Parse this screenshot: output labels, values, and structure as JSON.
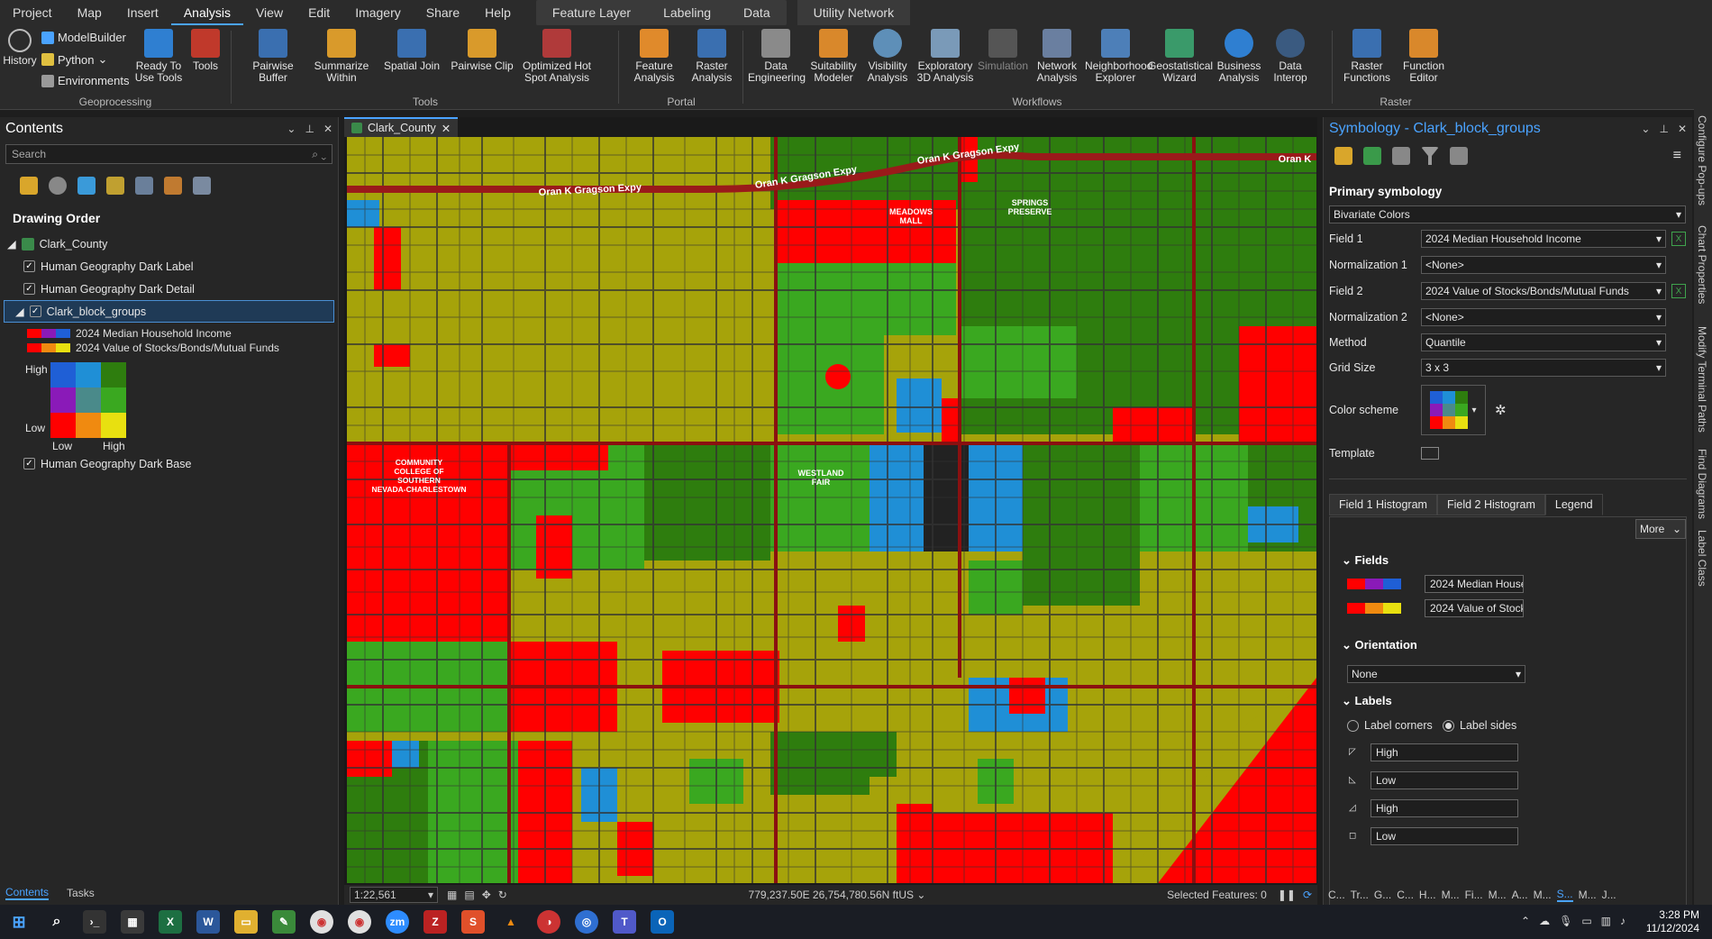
{
  "menu": [
    "Project",
    "Map",
    "Insert",
    "Analysis",
    "View",
    "Edit",
    "Imagery",
    "Share",
    "Help"
  ],
  "active_menu": "Analysis",
  "context_tabs": [
    "Feature Layer",
    "Labeling",
    "Data"
  ],
  "utility_tab": "Utility Network",
  "ribbon": {
    "geoprocessing": {
      "label": "Geoprocessing",
      "history": "History",
      "modelbuilder": "ModelBuilder",
      "python": "Python",
      "environments": "Environments",
      "ready": "Ready To Use Tools",
      "tools": "Tools"
    },
    "tools": {
      "label": "Tools",
      "items": [
        "Pairwise Buffer",
        "Summarize Within",
        "Spatial Join",
        "Pairwise Clip",
        "Optimized Hot Spot Analysis"
      ]
    },
    "portal": {
      "label": "Portal",
      "items": [
        "Feature Analysis",
        "Raster Analysis"
      ]
    },
    "workflows": {
      "label": "Workflows",
      "items": [
        "Data Engineering",
        "Suitability Modeler",
        "Visibility Analysis",
        "Exploratory 3D Analysis",
        "Simulation",
        "Network Analysis",
        "Neighborhood Explorer",
        "Geostatistical Wizard",
        "Business Analysis",
        "Data Interop"
      ]
    },
    "raster": {
      "label": "Raster",
      "items": [
        "Raster Functions",
        "Function Editor"
      ]
    }
  },
  "contents": {
    "title": "Contents",
    "search_placeholder": "Search",
    "drawing_order": "Drawing Order",
    "map_name": "Clark_County",
    "layers": [
      "Human Geography Dark Label",
      "Human Geography Dark Detail",
      "Clark_block_groups",
      "Human Geography Dark Base"
    ],
    "legend_field1": "2024 Median Household Income",
    "legend_field2": "2024 Value of Stocks/Bonds/Mutual Funds",
    "high": "High",
    "low": "Low",
    "bottom_tabs": [
      "Contents",
      "Tasks"
    ]
  },
  "map": {
    "tab": "Clark_County",
    "labels": {
      "expy1": "Oran K Gragson Expy",
      "expy2": "Oran K Gragson Expy",
      "expy3": "Oran K Gragson Expy",
      "expy4": "Oran K",
      "meadows": "MEADOWS MALL",
      "springs": "SPRINGS PRESERVE",
      "college": "COMMUNITY COLLEGE OF SOUTHERN NEVADA-CHARLESTOWN",
      "westland": "WESTLAND FAIR"
    },
    "scale": "1:22,561",
    "coords": "779,237.50E 26,754,780.56N ftUS",
    "selected": "Selected Features: 0"
  },
  "symbology": {
    "title": "Symbology - Clark_block_groups",
    "primary": "Primary symbology",
    "type": "Bivariate Colors",
    "field1_label": "Field 1",
    "field1": "2024 Median Household Income",
    "norm1_label": "Normalization 1",
    "norm1": "<None>",
    "field2_label": "Field 2",
    "field2": "2024 Value of Stocks/Bonds/Mutual Funds",
    "norm2_label": "Normalization 2",
    "norm2": "<None>",
    "method_label": "Method",
    "method": "Quantile",
    "grid_label": "Grid Size",
    "grid": "3 x 3",
    "scheme_label": "Color scheme",
    "template_label": "Template",
    "tabs": [
      "Field 1 Histogram",
      "Field 2 Histogram",
      "Legend"
    ],
    "more": "More",
    "fields_header": "Fields",
    "field1_short": "2024 Median House",
    "field2_short": "2024 Value of Stock",
    "orientation_header": "Orientation",
    "orientation": "None",
    "labels_header": "Labels",
    "label_corners": "Label corners",
    "label_sides": "Label sides",
    "label_values": [
      "High",
      "Low",
      "High",
      "Low"
    ]
  },
  "side_tabs": [
    "Configure Pop-ups",
    "Chart Properties",
    "Modify Terminal Paths",
    "Find Diagrams",
    "Label Class"
  ],
  "bottom_right_tabs": [
    "C...",
    "Tr...",
    "G...",
    "C...",
    "H...",
    "M...",
    "Fi...",
    "M...",
    "A...",
    "M...",
    "S...",
    "M...",
    "J..."
  ],
  "taskbar": {
    "time": "3:28 PM",
    "date": "11/12/2024"
  },
  "colors": {
    "accent": "#4aa3ff",
    "red": "#ff0000",
    "green": "#2e7d0e",
    "olive": "#a6a30a",
    "blue": "#1f8fd6"
  }
}
